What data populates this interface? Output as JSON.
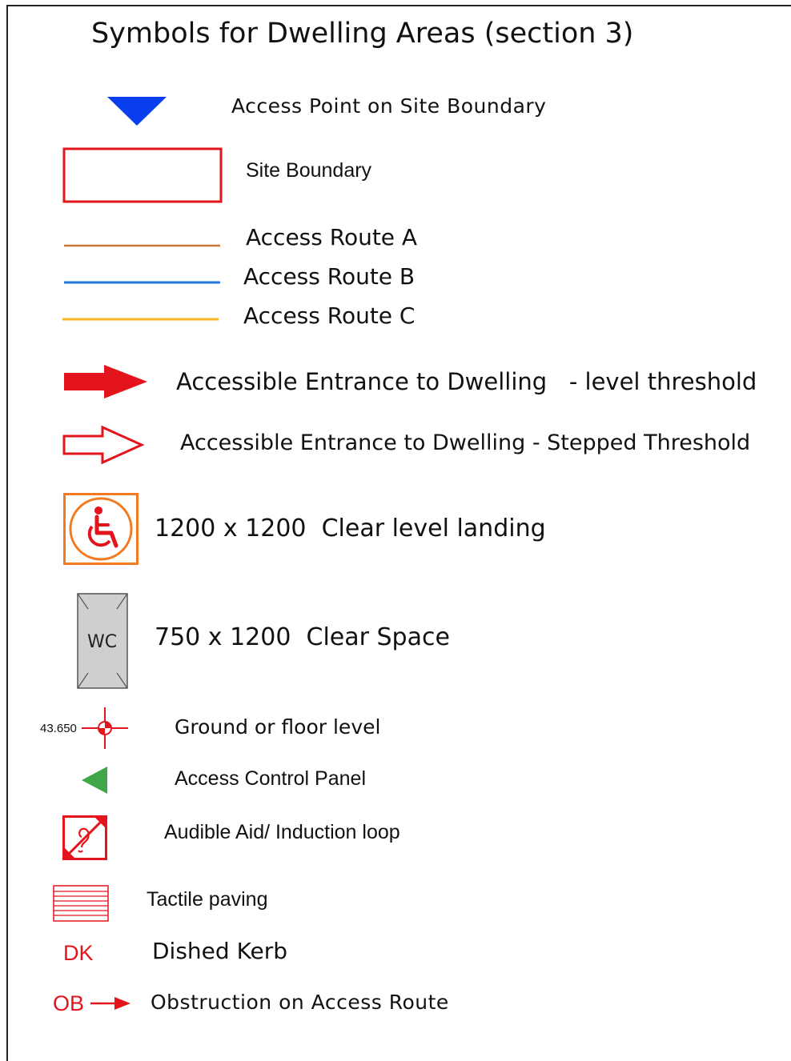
{
  "title": "Symbols for Dwelling Areas (section 3)",
  "legend": {
    "access_point": "Access Point on Site Boundary",
    "site_boundary": "Site Boundary",
    "route_a": "Access Route A",
    "route_b": "Access Route B",
    "route_c": "Access Route C",
    "entrance_level": "Accessible Entrance to Dwelling   - level threshold",
    "entrance_stepped": "Accessible Entrance to Dwelling - Stepped Threshold",
    "landing": "1200 x 1200  Clear level landing",
    "clear_space": "750 x 1200  Clear Space",
    "wc_label": "WC",
    "ground_level": "Ground or floor level",
    "level_value": "43.650",
    "control_panel": "Access Control Panel",
    "audible_aid": "Audible Aid/ Induction loop",
    "tactile": "Tactile paving",
    "dk_code": "DK",
    "dished_kerb": "Dished Kerb",
    "ob_code": "OB",
    "obstruction": "Obstruction on Access Route"
  },
  "colors": {
    "access_point": "#0a3ff0",
    "red": "#e3141b",
    "route_a": "#c8763a",
    "route_b": "#1e78e0",
    "route_c": "#f5b820",
    "landing_orange": "#f47a20",
    "wc_fill": "#cfcfcf",
    "control_green": "#3fa64a"
  }
}
